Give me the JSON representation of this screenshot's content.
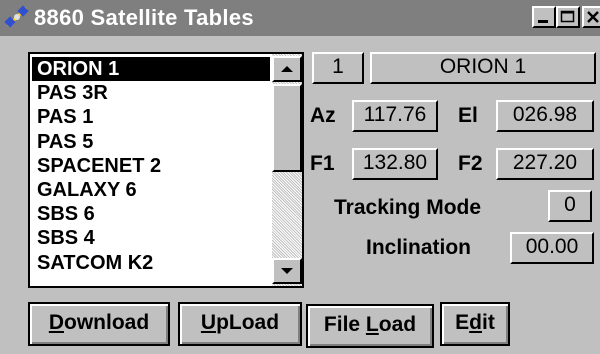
{
  "window": {
    "title": "8860 Satellite Tables",
    "icon": "satellite-icon",
    "colors": {
      "titlebar": "#7f7f7f",
      "face": "#c0c0c0",
      "selection": "#000000"
    }
  },
  "satellite_list": {
    "selected": "ORION 1",
    "items": [
      {
        "name": "ORION 1"
      },
      {
        "name": "PAS 3R"
      },
      {
        "name": "PAS 1"
      },
      {
        "name": "PAS 5"
      },
      {
        "name": "SPACENET 2"
      },
      {
        "name": "GALAXY 6"
      },
      {
        "name": "SBS 6"
      },
      {
        "name": "SBS 4"
      },
      {
        "name": "SATCOM K2"
      }
    ]
  },
  "details": {
    "index": "1",
    "name": "ORION 1",
    "az_label": "Az",
    "az": "117.76",
    "el_label": "El",
    "el": "026.98",
    "f1_label": "F1",
    "f1": "132.80",
    "f2_label": "F2",
    "f2": "227.20",
    "tracking_label": "Tracking Mode",
    "tracking": "0",
    "inclination_label": "Inclination",
    "inclination": "00.00"
  },
  "buttons": {
    "download": {
      "mnemonic": "D",
      "rest": "ownload"
    },
    "upload": {
      "mnemonic": "U",
      "rest": "pLoad"
    },
    "fileload": {
      "pre": "File ",
      "mnemonic": "L",
      "rest": "oad"
    },
    "edit": {
      "pre": "E",
      "mnemonic": "d",
      "rest": "it"
    }
  }
}
